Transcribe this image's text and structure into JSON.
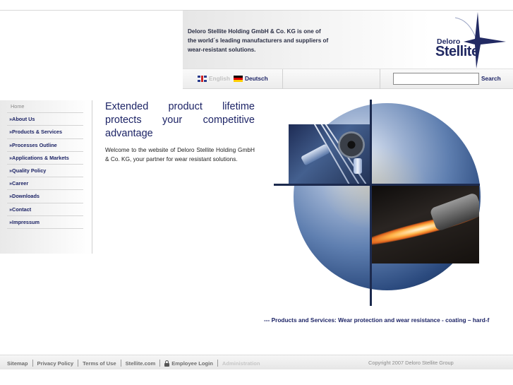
{
  "header": {
    "intro_text": "Deloro Stellite Holding GmbH & Co. KG is one of the world´s leading manufacturers and suppliers of wear-resistant solutions.",
    "logo": {
      "line1": "Deloro",
      "line2": "Stellite",
      "icon": "star-logo-icon",
      "color": "#222a63"
    }
  },
  "language": {
    "english": "English",
    "deutsch": "Deutsch"
  },
  "search": {
    "value": "",
    "placeholder": "",
    "button_label": "Search"
  },
  "nav": {
    "items": [
      {
        "label": "Home"
      },
      {
        "label": "»About Us"
      },
      {
        "label": "»Products & Services"
      },
      {
        "label": "»Processes Outline"
      },
      {
        "label": "»Applications & Markets"
      },
      {
        "label": "»Quality Policy"
      },
      {
        "label": "»Career"
      },
      {
        "label": "»Downloads"
      },
      {
        "label": "»Contact"
      },
      {
        "label": "»Impressum"
      }
    ]
  },
  "main": {
    "headline_lines": [
      "Extended product lifetime",
      "protects your competitive",
      "advantage"
    ],
    "welcome": "Welcome to the website of Deloro Stellite Holding GmbH & Co. KG, your partner for wear resistant solutions."
  },
  "ticker": {
    "text": "--- Products and Services: Wear protection and wear resistance - coating – hard-f"
  },
  "footer": {
    "sitemap": "Sitemap",
    "privacy": "Privacy Policy",
    "terms": "Terms of Use",
    "stellite_com": "Stellite.com",
    "employee_login": "Employee Login",
    "administration": "Administration",
    "copyright": "Copyright 2007 Deloro Stellite Group"
  },
  "colors": {
    "brand_navy": "#1d2466",
    "accent_line": "#1c2a4e"
  }
}
